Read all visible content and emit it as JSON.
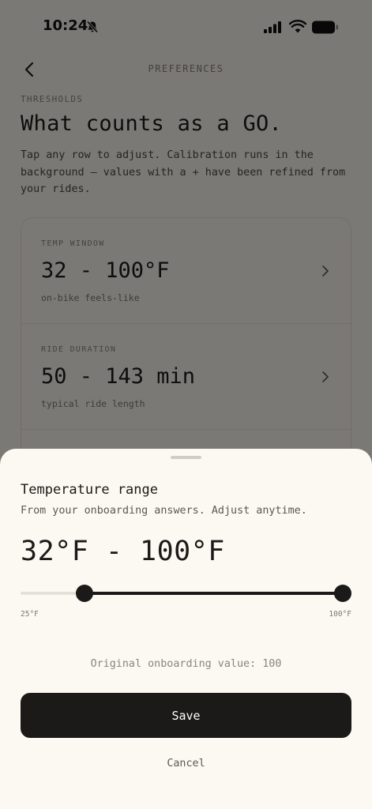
{
  "status_bar": {
    "time": "10:24",
    "icons": [
      "bell-slash-icon",
      "signal-icon",
      "wifi-icon",
      "battery-icon"
    ]
  },
  "header": {
    "title": "PREFERENCES",
    "back_icon": "chevron-left-icon"
  },
  "intro": {
    "section_label": "THRESHOLDS",
    "title": "What counts as a GO.",
    "description": "Tap any row to adjust. Calibration runs in the background — values with a + have been refined from your rides."
  },
  "thresholds": [
    {
      "label": "TEMP WINDOW",
      "value": "32 - 100°F",
      "subtitle": "on-bike feels-like"
    },
    {
      "label": "RIDE DURATION",
      "value": "50 - 143 min",
      "subtitle": "typical ride length"
    }
  ],
  "sheet": {
    "title": "Temperature range",
    "subtitle": "From your onboarding answers. Adjust anytime.",
    "range_text": "32°F - 100°F",
    "slider": {
      "min": 25,
      "max": 100,
      "low": 32,
      "high": 100,
      "min_label": "25°F",
      "max_label": "100°F"
    },
    "original_value": "Original onboarding value: 100",
    "save_label": "Save",
    "cancel_label": "Cancel"
  },
  "colors": {
    "background": "#f6f2ea",
    "sheet": "#fcf9f3",
    "primary": "#1b1a18",
    "muted": "#8a857d"
  }
}
